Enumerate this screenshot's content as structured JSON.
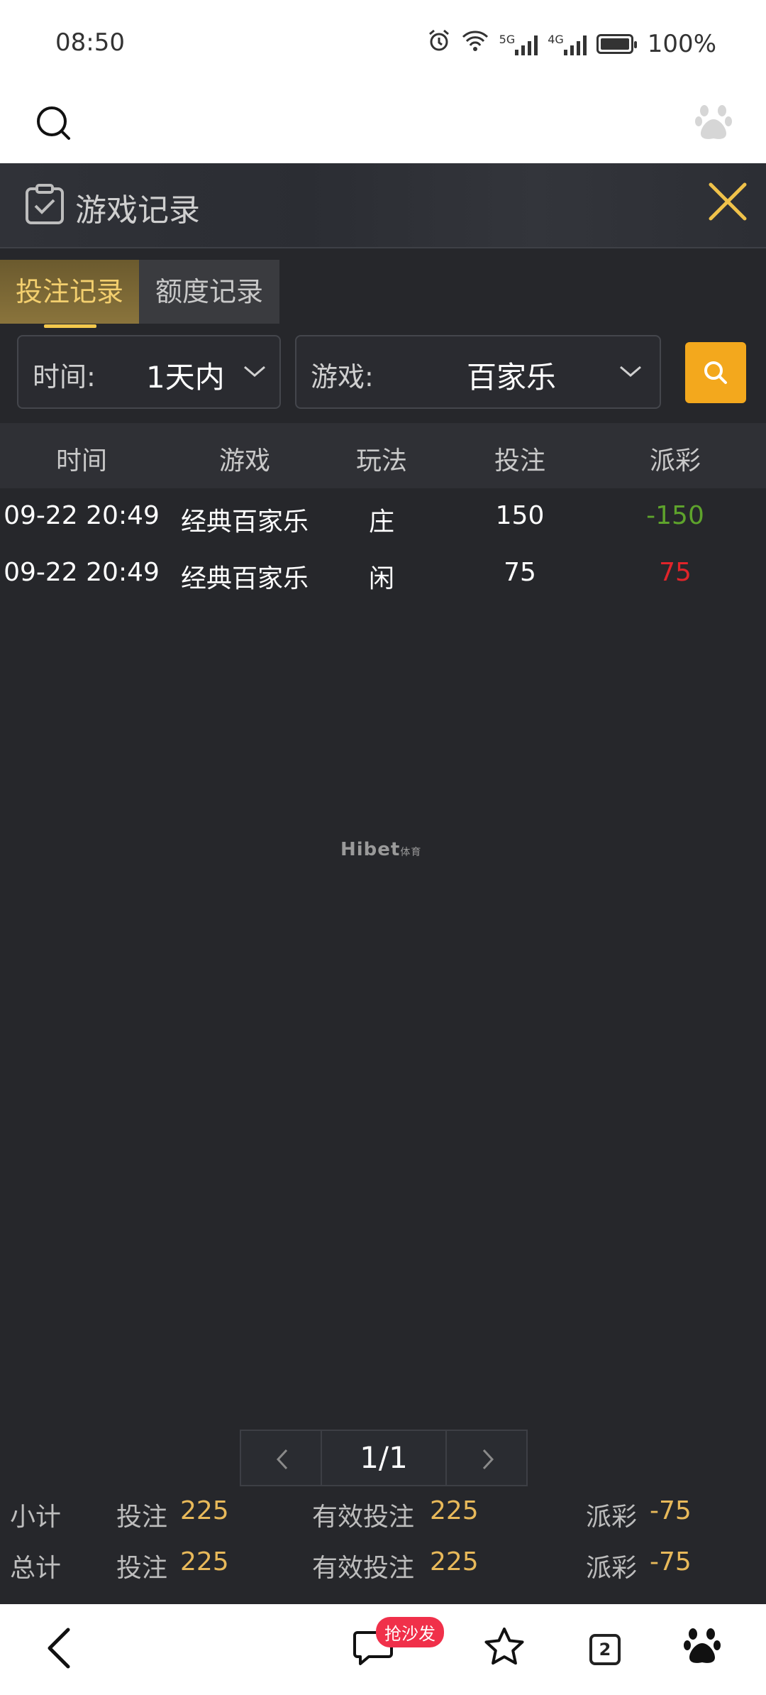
{
  "status_bar": {
    "time": "08:50",
    "battery": "100%",
    "net_5g": "5G",
    "net_4g": "4G"
  },
  "panel": {
    "title": "游戏记录",
    "tabs": [
      {
        "label": "投注记录",
        "active": true
      },
      {
        "label": "额度记录",
        "active": false
      }
    ],
    "filters": {
      "time": {
        "label": "时间:",
        "value": "1天内"
      },
      "game": {
        "label": "游戏:",
        "value": "百家乐"
      }
    },
    "table": {
      "headers": [
        "时间",
        "游戏",
        "玩法",
        "投注",
        "派彩"
      ],
      "rows": [
        {
          "time": "09-22 20:49",
          "game": "经典百家乐",
          "play": "庄",
          "bet": "150",
          "payout": "-150"
        },
        {
          "time": "09-22 20:49",
          "game": "经典百家乐",
          "play": "闲",
          "bet": "75",
          "payout": "75"
        }
      ]
    },
    "watermark": {
      "brand": "Hibet",
      "suffix": "体育"
    },
    "pagination": {
      "page": "1/1"
    },
    "subtotal": {
      "label": "小计",
      "bet_label": "投注",
      "bet": "225",
      "valid_label": "有效投注",
      "valid": "225",
      "payout_label": "派彩",
      "payout": "-75"
    },
    "total": {
      "label": "总计",
      "bet_label": "投注",
      "bet": "225",
      "valid_label": "有效投注",
      "valid": "225",
      "payout_label": "派彩",
      "payout": "-75"
    }
  },
  "bottom_nav": {
    "comment_badge": "抢沙发",
    "tab_count": "2"
  },
  "colors": {
    "accent": "#f3a81d",
    "gold_text": "#e8b95a",
    "negative": "#5ea32c",
    "positive": "#e0242a",
    "panel_bg": "#26272b"
  }
}
